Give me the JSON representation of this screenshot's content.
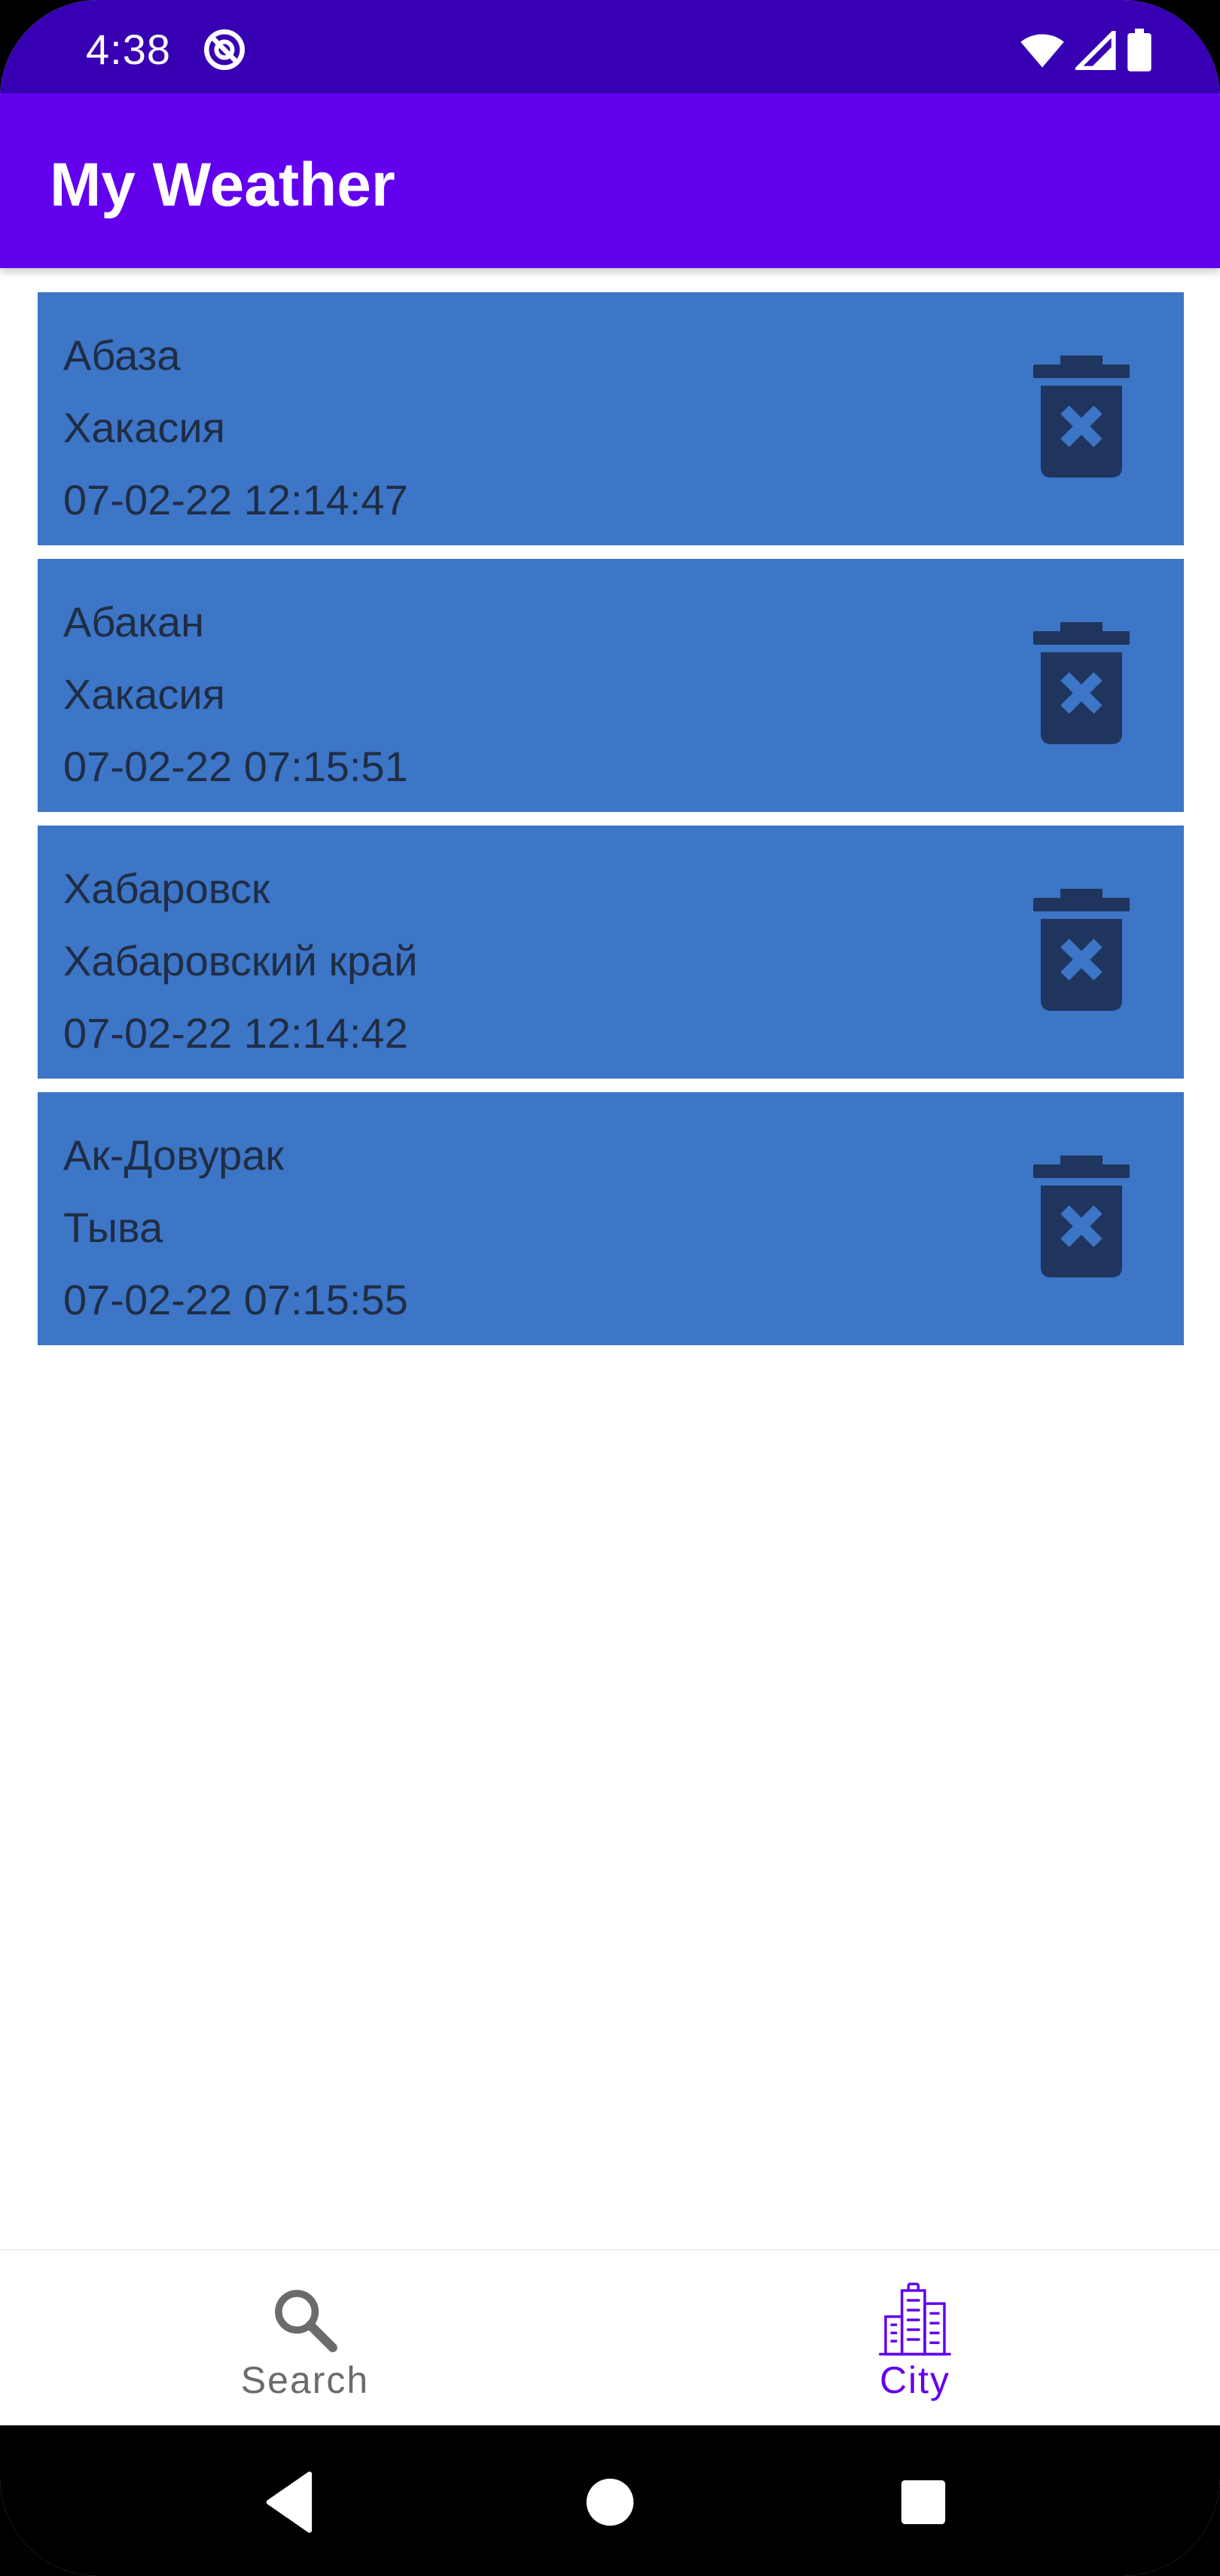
{
  "status_bar": {
    "time": "4:38",
    "icons": [
      "sync-disabled-icon",
      "wifi-icon",
      "signal-icon",
      "battery-icon"
    ]
  },
  "app_bar": {
    "title": "My Weather",
    "color": "#6200ee"
  },
  "cities": [
    {
      "name": "Абаза",
      "region": "Хакасия",
      "timestamp": "07-02-22 12:14:47"
    },
    {
      "name": "Абакан",
      "region": "Хакасия",
      "timestamp": "07-02-22 07:15:51"
    },
    {
      "name": "Хабаровск",
      "region": "Хабаровский край",
      "timestamp": "07-02-22 12:14:42"
    },
    {
      "name": "Ак-Довурак",
      "region": "Тыва",
      "timestamp": "07-02-22 07:15:55"
    }
  ],
  "card_color": "#3d75c7",
  "bottom_nav": {
    "items": [
      {
        "label": "Search",
        "icon": "search-icon",
        "active": false
      },
      {
        "label": "City",
        "icon": "city-icon",
        "active": true
      }
    ]
  },
  "system_nav": {
    "icons": [
      "back-icon",
      "home-icon",
      "recents-icon"
    ]
  }
}
